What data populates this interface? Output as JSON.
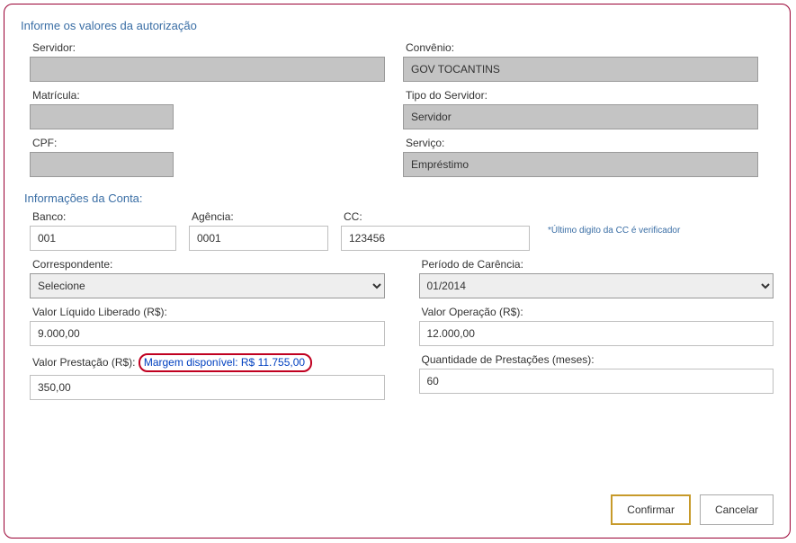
{
  "section_title": "Informe os valores da autorização",
  "sub_title": "Informações da Conta:",
  "labels": {
    "servidor": "Servidor:",
    "convenio": "Convênio:",
    "matricula": "Matrícula:",
    "tipo_servidor": "Tipo do Servidor:",
    "cpf": "CPF:",
    "servico": "Serviço:",
    "banco": "Banco:",
    "agencia": "Agência:",
    "cc": "CC:",
    "correspondente": "Correspondente:",
    "periodo_carencia": "Período de Carência:",
    "valor_liquido": "Valor Líquido Liberado (R$):",
    "valor_operacao": "Valor Operação (R$):",
    "valor_prestacao": "Valor Prestação (R$):",
    "qtd_prestacoes": "Quantidade de Prestações (meses):"
  },
  "values": {
    "servidor": "",
    "convenio": "GOV TOCANTINS",
    "matricula": "",
    "tipo_servidor": "Servidor",
    "cpf": "",
    "servico": "Empréstimo",
    "banco": "001",
    "agencia": "0001",
    "cc": "123456",
    "correspondente": "Selecione",
    "periodo_carencia": "01/2014",
    "valor_liquido": "9.000,00",
    "valor_operacao": "12.000,00",
    "valor_prestacao": "350,00",
    "qtd_prestacoes": "60"
  },
  "hint_cc": "*Último digito da CC é verificador",
  "margin_label": "Margem disponível: R$ 11.755,00",
  "buttons": {
    "confirmar": "Confirmar",
    "cancelar": "Cancelar"
  }
}
